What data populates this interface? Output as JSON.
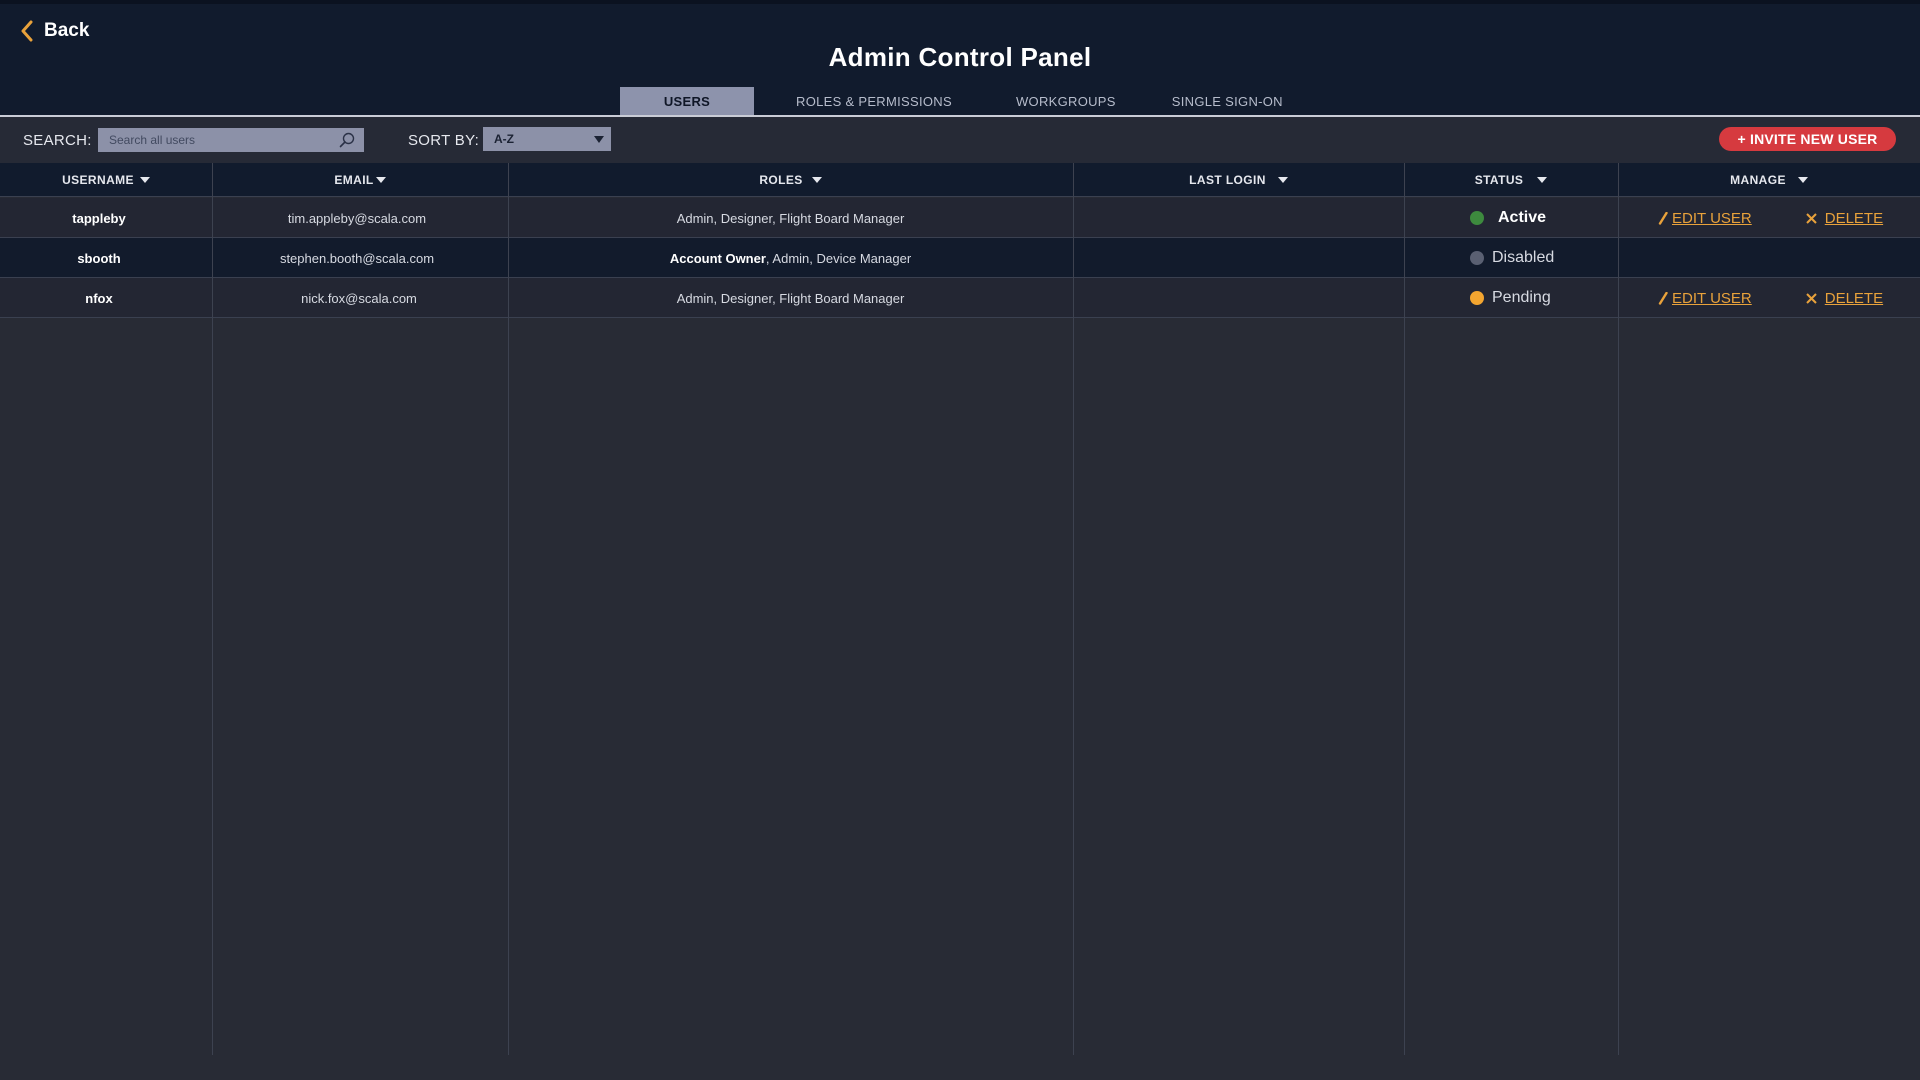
{
  "header": {
    "back_label": "Back",
    "title": "Admin Control Panel",
    "tabs": [
      {
        "label": "USERS",
        "active": true
      },
      {
        "label": "ROLES & PERMISSIONS",
        "active": false
      },
      {
        "label": "WORKGROUPS",
        "active": false
      },
      {
        "label": "SINGLE SIGN-ON",
        "active": false
      }
    ]
  },
  "toolbar": {
    "search_label": "SEARCH:",
    "search_placeholder": "Search all users",
    "search_value": "",
    "sort_label": "SORT BY:",
    "sort_value": "A-Z",
    "invite_label": "+ INVITE NEW USER"
  },
  "table": {
    "columns": [
      {
        "label": "USERNAME"
      },
      {
        "label": "EMAIL"
      },
      {
        "label": "ROLES"
      },
      {
        "label": "LAST LOGIN"
      },
      {
        "label": "STATUS"
      },
      {
        "label": "MANAGE"
      }
    ],
    "rows": [
      {
        "username": "tappleby",
        "email": "tim.appleby@scala.com",
        "roles_bold": "",
        "roles": "Admin, Designer, Flight Board Manager",
        "last_login": "",
        "status": "Active",
        "manage": {
          "edit": "EDIT USER",
          "delete": "DELETE"
        }
      },
      {
        "username": "sbooth",
        "email": "stephen.booth@scala.com",
        "roles_bold": "Account Owner",
        "roles": ", Admin, Device Manager",
        "last_login": "",
        "status": "Disabled",
        "manage": null
      },
      {
        "username": "nfox",
        "email": "nick.fox@scala.com",
        "roles_bold": "",
        "roles": "Admin, Designer, Flight Board Manager",
        "last_login": "",
        "status": "Pending",
        "manage": {
          "edit": "EDIT USER",
          "delete": "DELETE"
        }
      }
    ]
  },
  "icons": {
    "back": "chevron-left-icon",
    "search": "magnifier-icon",
    "sort": "caret-down-icon",
    "edit": "pencil-icon",
    "delete": "close-icon"
  },
  "colors": {
    "accent": "#e9a23b",
    "invite": "#d63a3f",
    "status_active": "#3d8a3e",
    "status_disabled": "#5a6072",
    "status_pending": "#f3a530"
  }
}
